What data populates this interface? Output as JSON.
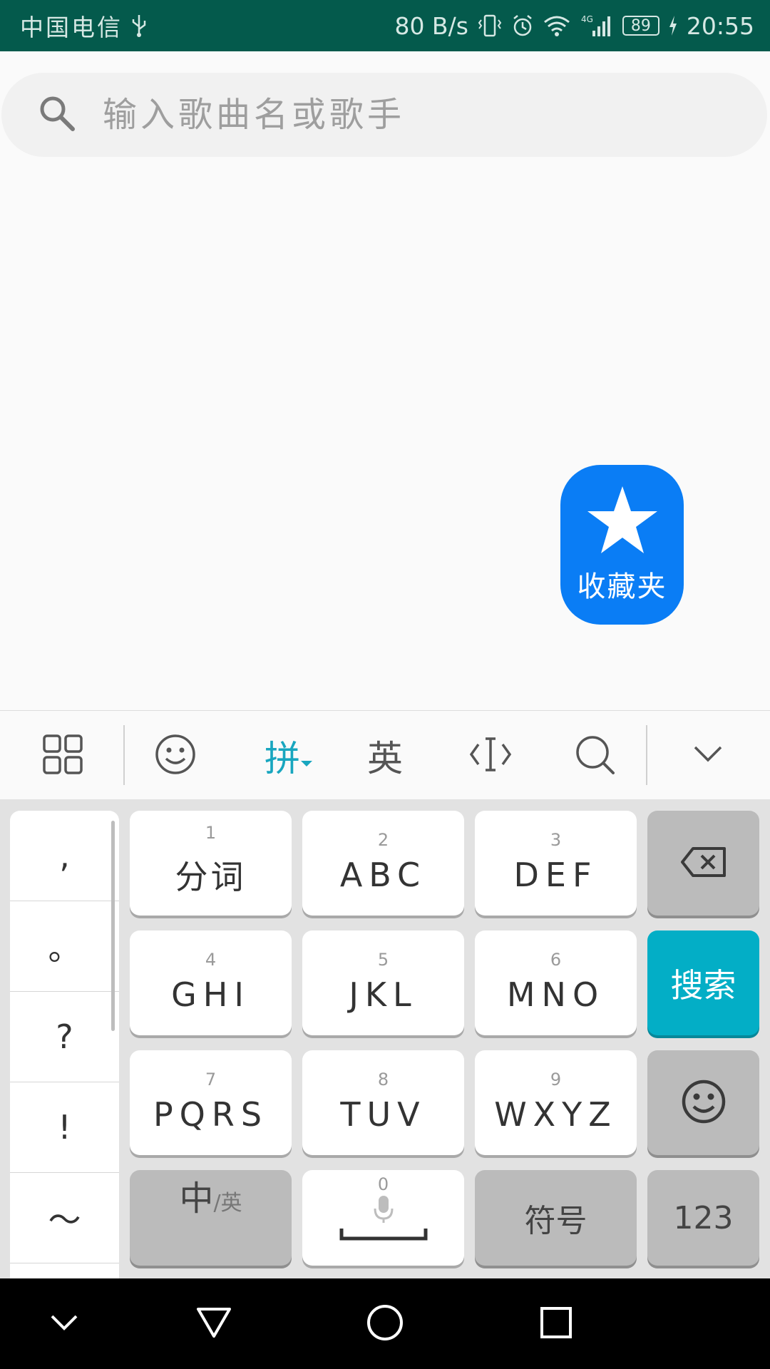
{
  "status_bar": {
    "carrier": "中国电信",
    "net_speed": "80 B/s",
    "network_type": "4G",
    "battery": "89",
    "time": "20:55"
  },
  "search": {
    "placeholder": "输入歌曲名或歌手",
    "value": ""
  },
  "favorites": {
    "label": "收藏夹",
    "icon": "star-icon",
    "color": "#0a7df5"
  },
  "keyboard_toolbar": {
    "pinyin_label": "拼",
    "english_label": "英"
  },
  "keyboard": {
    "punctuation": [
      ",",
      "。",
      "?",
      "!",
      "～"
    ],
    "rows": [
      [
        {
          "num": "1",
          "label": "分词"
        },
        {
          "num": "2",
          "label": "ABC"
        },
        {
          "num": "3",
          "label": "DEF"
        }
      ],
      [
        {
          "num": "4",
          "label": "GHI"
        },
        {
          "num": "5",
          "label": "JKL"
        },
        {
          "num": "6",
          "label": "MNO"
        }
      ],
      [
        {
          "num": "7",
          "label": "PQRS"
        },
        {
          "num": "8",
          "label": "TUV"
        },
        {
          "num": "9",
          "label": "WXYZ"
        }
      ]
    ],
    "search_key": "搜索",
    "lang_key_main": "中",
    "lang_key_sub": "/英",
    "space_num": "0",
    "symbol_key": "符号",
    "num_key": "123",
    "accent_color": "#03aec6"
  },
  "nav_bar": {
    "buttons": [
      "hide-keyboard-icon",
      "back-icon",
      "home-icon",
      "recents-icon"
    ]
  }
}
